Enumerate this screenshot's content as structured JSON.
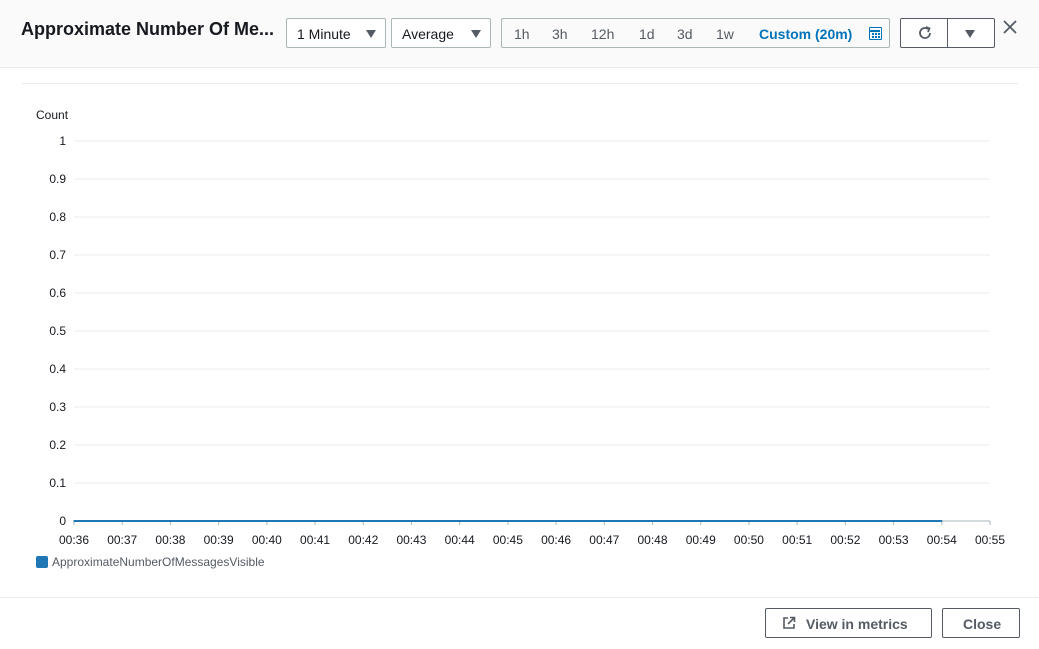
{
  "header": {
    "title": "Approximate Number Of Me...",
    "period_select": {
      "value": "1 Minute"
    },
    "statistic_select": {
      "value": "Average"
    },
    "time_ranges": [
      {
        "label": "1h"
      },
      {
        "label": "3h"
      },
      {
        "label": "12h"
      },
      {
        "label": "1d"
      },
      {
        "label": "3d"
      },
      {
        "label": "1w"
      },
      {
        "label": "Custom (20m)",
        "active": true
      }
    ],
    "icons": {
      "calendar": "calendar-icon",
      "refresh": "refresh-icon",
      "dropdown": "chevron-down-icon",
      "close": "close-icon"
    }
  },
  "chart_data": {
    "type": "line",
    "ylabel": "Count",
    "ylim": [
      0,
      1
    ],
    "yticks": [
      "1",
      "0.9",
      "0.8",
      "0.7",
      "0.6",
      "0.5",
      "0.4",
      "0.3",
      "0.2",
      "0.1",
      "0"
    ],
    "ytick_values": [
      1,
      0.9,
      0.8,
      0.7,
      0.6,
      0.5,
      0.4,
      0.3,
      0.2,
      0.1,
      0
    ],
    "x": [
      "00:36",
      "00:37",
      "00:38",
      "00:39",
      "00:40",
      "00:41",
      "00:42",
      "00:43",
      "00:44",
      "00:45",
      "00:46",
      "00:47",
      "00:48",
      "00:49",
      "00:50",
      "00:51",
      "00:52",
      "00:53",
      "00:54",
      "00:55"
    ],
    "series": [
      {
        "name": "ApproximateNumberOfMessagesVisible",
        "color": "#1f77b4",
        "x": [
          "00:36",
          "00:37",
          "00:38",
          "00:39",
          "00:40",
          "00:41",
          "00:42",
          "00:43",
          "00:44",
          "00:45",
          "00:46",
          "00:47",
          "00:48",
          "00:49",
          "00:50",
          "00:51",
          "00:52",
          "00:53",
          "00:54"
        ],
        "values": [
          0,
          0,
          0,
          0,
          0,
          0,
          0,
          0,
          0,
          0,
          0,
          0,
          0,
          0,
          0,
          0,
          0,
          0,
          0
        ]
      }
    ],
    "grid": true,
    "legend": "bottom-left"
  },
  "footer": {
    "view_in_metrics": "View in metrics",
    "close": "Close",
    "external_icon": "external-link-icon"
  }
}
